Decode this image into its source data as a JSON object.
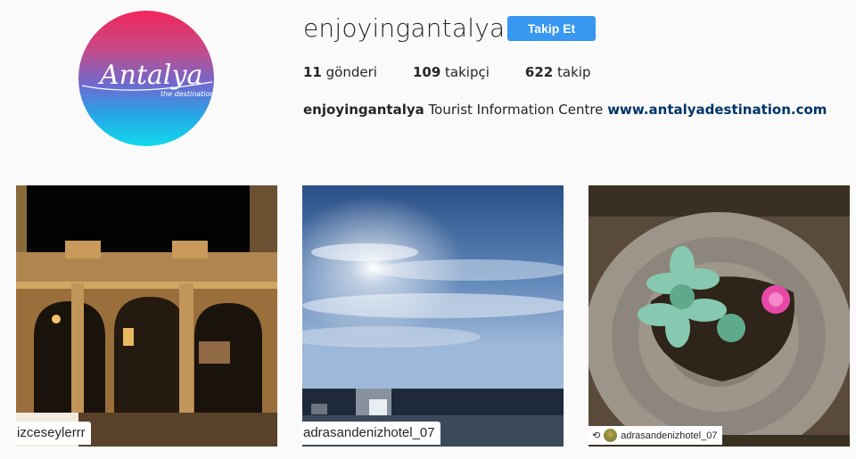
{
  "profile": {
    "username": "enjoyingantalya",
    "follow_label": "Takip Et",
    "avatar_text": "Antalya",
    "avatar_subtext": "the destination"
  },
  "stats": [
    {
      "count": "11",
      "label": "gönderi"
    },
    {
      "count": "109",
      "label": "takipçi"
    },
    {
      "count": "622",
      "label": "takip"
    }
  ],
  "bio": {
    "name": "enjoyingantalya",
    "text": "Tourist Information Centre",
    "link": "www.antalyadestination.com"
  },
  "posts": [
    {
      "overlay": "izceseylerrr"
    },
    {
      "overlay": "adrasandenizhotel_07"
    },
    {
      "overlay": "adrasandenizhotel_07"
    }
  ],
  "colors": {
    "follow_button": "#3897f0",
    "link": "#003569"
  }
}
